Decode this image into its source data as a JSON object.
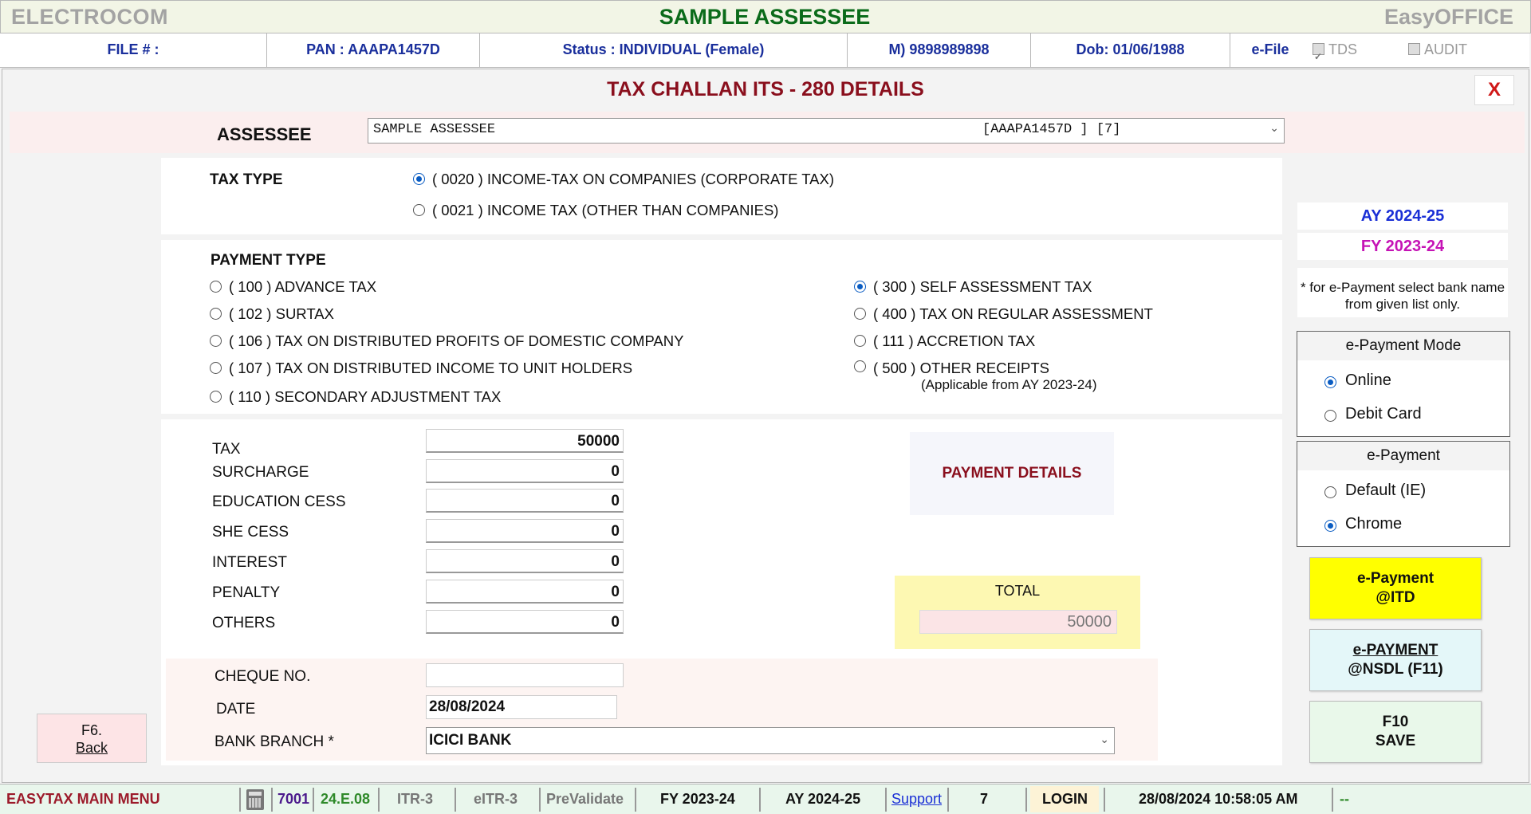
{
  "titlebar": {
    "left": "ELECTROCOM",
    "center": "SAMPLE ASSESSEE",
    "right": "EasyOFFICE"
  },
  "infobar": {
    "file": "FILE # :",
    "pan": "PAN : AAAPA1457D",
    "status": "Status : INDIVIDUAL (Female)",
    "mobile": "M) 9898989898",
    "dob": "Dob: 01/06/1988",
    "efile": "e-File",
    "tds": "TDS",
    "audit": "AUDIT"
  },
  "form": {
    "title": "TAX CHALLAN ITS - 280 DETAILS",
    "close": "X",
    "assessee_label": "ASSESSEE",
    "assessee_name": "SAMPLE ASSESSEE",
    "assessee_pan": "[AAAPA1457D ] [7]",
    "tax_type_label": "TAX TYPE",
    "tax_types": [
      "( 0020 ) INCOME-TAX ON COMPANIES (CORPORATE TAX)",
      "( 0021 ) INCOME TAX (OTHER THAN COMPANIES)"
    ],
    "tax_type_selected": 0,
    "payment_type_label": "PAYMENT TYPE",
    "payment_left": [
      "( 100 ) ADVANCE TAX",
      "( 102 ) SURTAX",
      "( 106 ) TAX ON DISTRIBUTED PROFITS OF DOMESTIC COMPANY",
      "( 107 ) TAX ON DISTRIBUTED INCOME TO UNIT HOLDERS",
      "( 110 ) SECONDARY ADJUSTMENT TAX"
    ],
    "payment_right": [
      "( 300 ) SELF ASSESSMENT TAX",
      "( 400 ) TAX ON REGULAR ASSESSMENT",
      "( 111 ) ACCRETION TAX",
      "( 500 ) OTHER RECEIPTS"
    ],
    "payment_right_note": "(Applicable from  AY 2023-24)",
    "payment_selected": "( 300 ) SELF ASSESSMENT TAX",
    "amounts": [
      {
        "label": "TAX",
        "value": "50000"
      },
      {
        "label": "SURCHARGE",
        "value": "0"
      },
      {
        "label": "EDUCATION CESS",
        "value": "0"
      },
      {
        "label": "SHE CESS",
        "value": "0"
      },
      {
        "label": "INTEREST",
        "value": "0"
      },
      {
        "label": "PENALTY",
        "value": "0"
      },
      {
        "label": "OTHERS",
        "value": "0"
      }
    ],
    "payment_details": "PAYMENT DETAILS",
    "total_label": "TOTAL",
    "total_value": "50000",
    "cheque_label": "CHEQUE NO.",
    "cheque_value": "",
    "date_label": "DATE",
    "date_value": "28/08/2024",
    "bank_label": "BANK BRANCH *",
    "bank_value": "ICICI BANK",
    "back_btn_line1": "F6.",
    "back_btn_line2": "Back"
  },
  "side": {
    "ay": "AY 2024-25",
    "fy": "FY 2023-24",
    "note": "* for e-Payment select bank name from given list only.",
    "mode_title": "e-Payment Mode",
    "mode_options": [
      "Online",
      "Debit Card"
    ],
    "mode_selected": 0,
    "browser_title": "e-Payment",
    "browser_options": [
      "Default (IE)",
      "Chrome"
    ],
    "browser_selected": 1,
    "btn_itd_1": "e-Payment",
    "btn_itd_2": "@ITD",
    "btn_nsdl_1": "e-PAYMENT",
    "btn_nsdl_2": "@NSDL  (F11)",
    "btn_save_1": "F10",
    "btn_save_2": "SAVE",
    "colors": {
      "itd": "#ffff00",
      "nsdl": "#e4f7f9",
      "save": "#e9f8ea"
    }
  },
  "statusbar": {
    "menu": "EASYTAX MAIN MENU",
    "code": "7001",
    "version": "24.E.08",
    "itr": "ITR-3",
    "eitr": "eITR-3",
    "prevalidate": "PreValidate",
    "fy": "FY 2023-24",
    "ay": "AY 2024-25",
    "support": "Support",
    "num": "7",
    "login": "LOGIN",
    "datetime": "28/08/2024 10:58:05 AM",
    "dash": "--"
  }
}
